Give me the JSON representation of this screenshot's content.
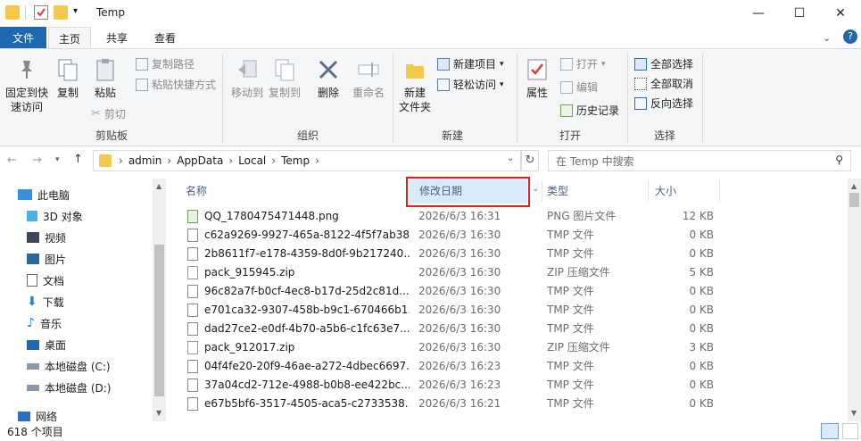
{
  "window": {
    "title": "Temp",
    "minimize": "—",
    "maximize": "☐",
    "close": "✕"
  },
  "tabs": {
    "file": "文件",
    "home": "主页",
    "share": "共享",
    "view": "查看"
  },
  "ribbon": {
    "clipboard": {
      "pin": "固定到快\n速访问",
      "copy": "复制",
      "paste": "粘贴",
      "copy_path": "复制路径",
      "paste_shortcut": "粘贴快捷方式",
      "cut": "剪切",
      "label": "剪贴板"
    },
    "organize": {
      "move_to": "移动到",
      "copy_to": "复制到",
      "delete": "删除",
      "rename": "重命名",
      "label": "组织"
    },
    "new": {
      "new_folder": "新建\n文件夹",
      "new_item": "新建项目",
      "easy_access": "轻松访问",
      "label": "新建"
    },
    "open": {
      "properties": "属性",
      "open": "打开",
      "edit": "编辑",
      "history": "历史记录",
      "label": "打开"
    },
    "select": {
      "select_all": "全部选择",
      "select_none": "全部取消",
      "invert": "反向选择",
      "label": "选择"
    }
  },
  "address": {
    "crumbs": [
      "admin",
      "AppData",
      "Local",
      "Temp"
    ],
    "search_placeholder": "在 Temp 中搜索"
  },
  "sidebar": {
    "items": [
      "此电脑",
      "3D 对象",
      "视频",
      "图片",
      "文档",
      "下载",
      "音乐",
      "桌面",
      "本地磁盘 (C:)",
      "本地磁盘 (D:)",
      "网络"
    ]
  },
  "columns": {
    "name": "名称",
    "date": "修改日期",
    "type": "类型",
    "size": "大小"
  },
  "files": [
    {
      "name": "QQ_1780475471448.png",
      "date": "2026/6/3 16:31",
      "type": "PNG 图片文件",
      "size": "12 KB",
      "kind": "png"
    },
    {
      "name": "c62a9269-9927-465a-8122-4f5f7ab38...",
      "date": "2026/6/3 16:30",
      "type": "TMP 文件",
      "size": "0 KB",
      "kind": "tmp"
    },
    {
      "name": "2b8611f7-e178-4359-8d0f-9b217240...",
      "date": "2026/6/3 16:30",
      "type": "TMP 文件",
      "size": "0 KB",
      "kind": "tmp"
    },
    {
      "name": "pack_915945.zip",
      "date": "2026/6/3 16:30",
      "type": "ZIP 压缩文件",
      "size": "5 KB",
      "kind": "zip"
    },
    {
      "name": "96c82a7f-b0cf-4ec8-b17d-25d2c81d...",
      "date": "2026/6/3 16:30",
      "type": "TMP 文件",
      "size": "0 KB",
      "kind": "tmp"
    },
    {
      "name": "e701ca32-9307-458b-b9c1-670466b1...",
      "date": "2026/6/3 16:30",
      "type": "TMP 文件",
      "size": "0 KB",
      "kind": "tmp"
    },
    {
      "name": "dad27ce2-e0df-4b70-a5b6-c1fc63e7...",
      "date": "2026/6/3 16:30",
      "type": "TMP 文件",
      "size": "0 KB",
      "kind": "tmp"
    },
    {
      "name": "pack_912017.zip",
      "date": "2026/6/3 16:30",
      "type": "ZIP 压缩文件",
      "size": "3 KB",
      "kind": "zip"
    },
    {
      "name": "04f4fe20-20f9-46ae-a272-4dbec6697...",
      "date": "2026/6/3 16:23",
      "type": "TMP 文件",
      "size": "0 KB",
      "kind": "tmp"
    },
    {
      "name": "37a04cd2-712e-4988-b0b8-ee422bc...",
      "date": "2026/6/3 16:23",
      "type": "TMP 文件",
      "size": "0 KB",
      "kind": "tmp"
    },
    {
      "name": "e67b5bf6-3517-4505-aca5-c2733538...",
      "date": "2026/6/3 16:21",
      "type": "TMP 文件",
      "size": "0 KB",
      "kind": "tmp"
    }
  ],
  "status": {
    "count": "618 个项目"
  }
}
